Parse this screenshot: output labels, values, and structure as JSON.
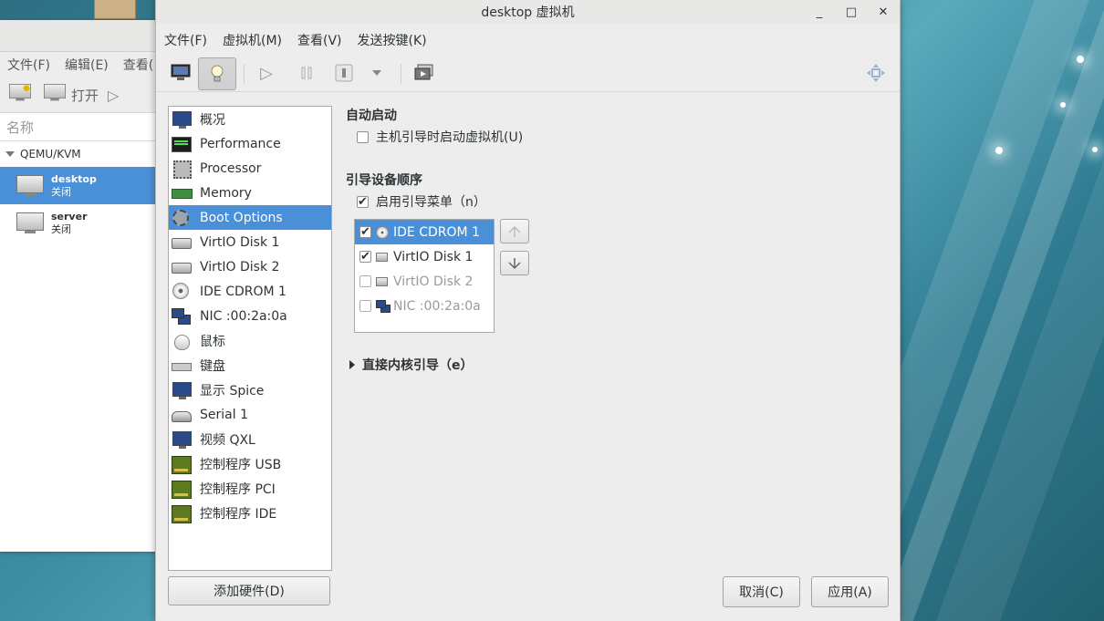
{
  "bg_window": {
    "menu": [
      "文件(F)",
      "编辑(E)",
      "查看("
    ],
    "toolbar_open": "打开",
    "col_header": "名称",
    "group": "QEMU/KVM",
    "vms": [
      {
        "name": "desktop",
        "status": "关闭",
        "selected": true
      },
      {
        "name": "server",
        "status": "关闭",
        "selected": false
      }
    ]
  },
  "dialog": {
    "title": "desktop 虚拟机",
    "window_controls": {
      "minimize": "_",
      "maximize": "□",
      "close": "✕"
    },
    "menu": [
      "文件(F)",
      "虚拟机(M)",
      "查看(V)",
      "发送按键(K)"
    ],
    "hardware": [
      {
        "label": "概况",
        "icon": "overview-monitor-icon"
      },
      {
        "label": "Performance",
        "icon": "performance-icon"
      },
      {
        "label": "Processor",
        "icon": "processor-chip-icon"
      },
      {
        "label": "Memory",
        "icon": "memory-module-icon"
      },
      {
        "label": "Boot Options",
        "icon": "boot-gear-icon",
        "selected": true
      },
      {
        "label": "VirtIO Disk 1",
        "icon": "disk-icon"
      },
      {
        "label": "VirtIO Disk 2",
        "icon": "disk-icon"
      },
      {
        "label": "IDE CDROM 1",
        "icon": "cdrom-icon"
      },
      {
        "label": "NIC :00:2a:0a",
        "icon": "network-icon"
      },
      {
        "label": "鼠标",
        "icon": "mouse-icon"
      },
      {
        "label": "键盘",
        "icon": "keyboard-icon"
      },
      {
        "label": "显示 Spice",
        "icon": "display-icon"
      },
      {
        "label": "Serial 1",
        "icon": "serial-icon"
      },
      {
        "label": "视频 QXL",
        "icon": "video-icon"
      },
      {
        "label": "控制程序 USB",
        "icon": "controller-card-icon"
      },
      {
        "label": "控制程序 PCI",
        "icon": "controller-card-icon"
      },
      {
        "label": "控制程序 IDE",
        "icon": "controller-card-icon"
      }
    ],
    "add_hardware": "添加硬件(D)",
    "autostart": {
      "title": "自动启动",
      "checkbox_label": "主机引导时启动虚拟机(U)",
      "checked": false
    },
    "boot_order": {
      "title": "引导设备顺序",
      "menu_checkbox_label": "启用引导菜单（n）",
      "menu_checked": true,
      "devices": [
        {
          "label": "IDE CDROM 1",
          "checked": true,
          "selected": true,
          "icon": "cdrom-icon"
        },
        {
          "label": "VirtIO Disk 1",
          "checked": true,
          "selected": false,
          "icon": "disk-icon"
        },
        {
          "label": "VirtIO Disk 2",
          "checked": false,
          "selected": false,
          "icon": "disk-icon"
        },
        {
          "label": "NIC :00:2a:0a",
          "checked": false,
          "selected": false,
          "icon": "network-icon"
        }
      ]
    },
    "kernel_boot": "直接内核引导（e）",
    "cancel": "取消(C)",
    "apply": "应用(A)"
  },
  "colors": {
    "selection": "#4a90d9",
    "dialog_bg": "#ededed"
  }
}
